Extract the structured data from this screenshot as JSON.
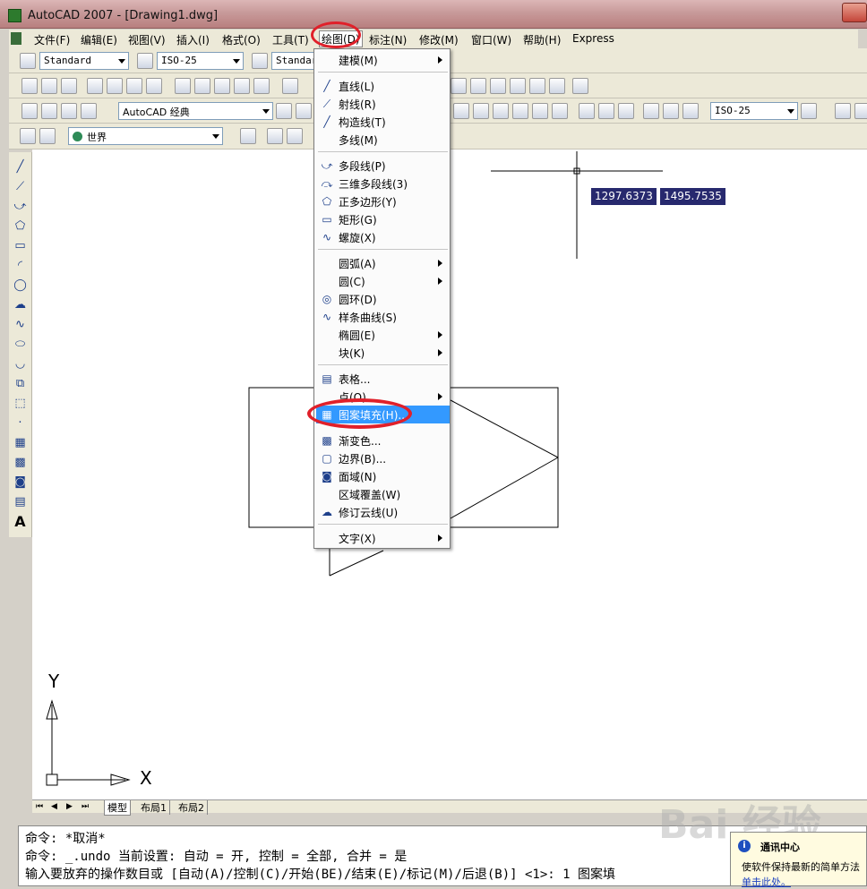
{
  "window": {
    "title": "AutoCAD 2007 - [Drawing1.dwg]"
  },
  "menubar": {
    "items": [
      "文件(F)",
      "编辑(E)",
      "视图(V)",
      "插入(I)",
      "格式(O)",
      "工具(T)",
      "绘图(D)",
      "标注(N)",
      "修改(M)",
      "窗口(W)",
      "帮助(H)",
      "Express"
    ]
  },
  "toolbars": {
    "text_style": "Standard",
    "dim_style": "ISO-25",
    "table_style": "Standard",
    "workspace": "AutoCAD 经典",
    "ucs": "世界",
    "dim_style_right": "ISO-25"
  },
  "coords": {
    "x": "1297.6373",
    "y": "1495.7535"
  },
  "draw_menu": {
    "items": [
      {
        "label": "建模(M)",
        "icon": "",
        "submenu": true
      },
      {
        "label": "直线(L)",
        "icon": "line-icon",
        "submenu": false
      },
      {
        "label": "射线(R)",
        "icon": "ray-icon",
        "submenu": false
      },
      {
        "label": "构造线(T)",
        "icon": "xline-icon",
        "submenu": false
      },
      {
        "label": "多线(M)",
        "icon": "",
        "submenu": false
      },
      {
        "label": "多段线(P)",
        "icon": "polyline-icon",
        "submenu": false
      },
      {
        "label": "三维多段线(3)",
        "icon": "3dpoly-icon",
        "submenu": false
      },
      {
        "label": "正多边形(Y)",
        "icon": "polygon-icon",
        "submenu": false
      },
      {
        "label": "矩形(G)",
        "icon": "rectangle-icon",
        "submenu": false
      },
      {
        "label": "螺旋(X)",
        "icon": "helix-icon",
        "submenu": false
      },
      {
        "label": "圆弧(A)",
        "icon": "",
        "submenu": true
      },
      {
        "label": "圆(C)",
        "icon": "",
        "submenu": true
      },
      {
        "label": "圆环(D)",
        "icon": "donut-icon",
        "submenu": false
      },
      {
        "label": "样条曲线(S)",
        "icon": "spline-icon",
        "submenu": false
      },
      {
        "label": "椭圆(E)",
        "icon": "",
        "submenu": true
      },
      {
        "label": "块(K)",
        "icon": "",
        "submenu": true
      },
      {
        "label": "表格...",
        "icon": "table-icon",
        "submenu": false
      },
      {
        "label": "点(O)",
        "icon": "",
        "submenu": true
      },
      {
        "label": "图案填充(H)...",
        "icon": "hatch-icon",
        "submenu": false
      },
      {
        "label": "渐变色...",
        "icon": "gradient-icon",
        "submenu": false
      },
      {
        "label": "边界(B)...",
        "icon": "boundary-icon",
        "submenu": false
      },
      {
        "label": "面域(N)",
        "icon": "region-icon",
        "submenu": false
      },
      {
        "label": "区域覆盖(W)",
        "icon": "",
        "submenu": false
      },
      {
        "label": "修订云线(U)",
        "icon": "revcloud-icon",
        "submenu": false
      },
      {
        "label": "文字(X)",
        "icon": "",
        "submenu": true
      }
    ]
  },
  "layout_tabs": [
    "模型",
    "布局1",
    "布局2"
  ],
  "axis": {
    "x_label": "X",
    "y_label": "Y"
  },
  "command_history": [
    "命令: *取消*",
    "命令: _.undo 当前设置: 自动 = 开, 控制 = 全部, 合并 = 是",
    "输入要放弃的操作数目或 [自动(A)/控制(C)/开始(BE)/结束(E)/标记(M)/后退(B)] <1>: 1 图案填"
  ],
  "notification": {
    "title": "通讯中心",
    "body": "使软件保持最新的简单方法",
    "link": "单击此处。"
  },
  "watermark": "Bai 经验"
}
